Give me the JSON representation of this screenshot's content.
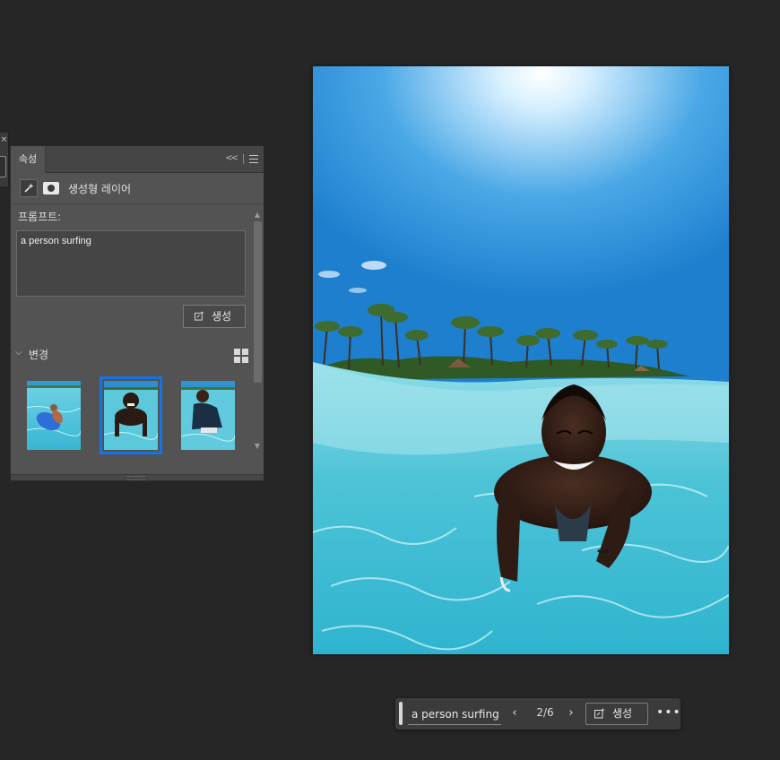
{
  "left_strip": {
    "close_glyph": "×"
  },
  "properties_panel": {
    "tab_label": "속성",
    "collapse_glyph": "<<",
    "menu_icon": "hamburger-menu-icon",
    "layer": {
      "type_icon": "generative-sparkle-icon",
      "mask_icon": "layer-mask-icon",
      "name": "생성형 레이어"
    },
    "prompt": {
      "label": "프롬프트:",
      "value": "a person surfing"
    },
    "generate_button": {
      "label": "생성",
      "icon": "generate-icon"
    },
    "variations": {
      "label": "변경",
      "chevron": "⌵",
      "grid_icon": "grid-view-icon",
      "thumbnails": [
        {
          "name": "variation-1",
          "selected": false
        },
        {
          "name": "variation-2",
          "selected": true
        },
        {
          "name": "variation-3",
          "selected": false
        }
      ]
    }
  },
  "canvas": {
    "description_icon": "generated-image"
  },
  "task_bar": {
    "prompt_value": "a person surfing",
    "prev_glyph": "‹",
    "next_glyph": "›",
    "counter": "2/6",
    "generate_label": "생성",
    "more_glyph": "•••"
  },
  "colors": {
    "app_background": "#262626",
    "panel_background": "#535353",
    "selection_accent": "#1473e6"
  }
}
